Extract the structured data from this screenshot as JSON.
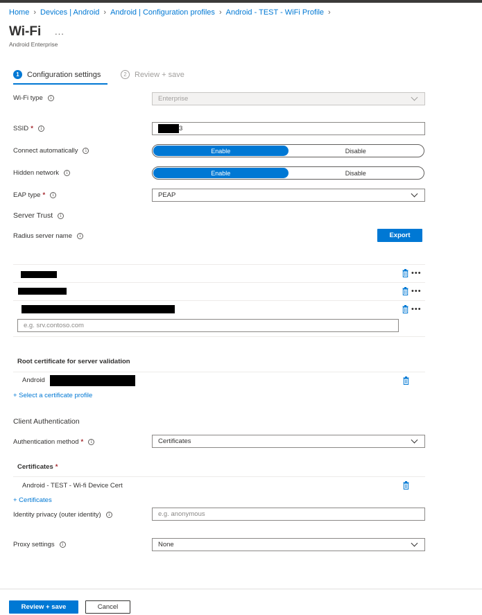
{
  "breadcrumb": [
    "Home",
    "Devices | Android",
    "Android | Configuration profiles",
    "Android - TEST - WiFi Profile"
  ],
  "header": {
    "title": "Wi-Fi",
    "more": "...",
    "subtitle": "Android Enterprise"
  },
  "steps": [
    {
      "num": "1",
      "label": "Configuration settings"
    },
    {
      "num": "2",
      "label": "Review + save"
    }
  ],
  "form": {
    "wifi_type": {
      "label": "Wi-Fi type",
      "value": "Enterprise"
    },
    "ssid": {
      "label": "SSID",
      "value": "3"
    },
    "connect_auto": {
      "label": "Connect automatically",
      "on": "Enable",
      "off": "Disable",
      "selected": "Enable"
    },
    "hidden_network": {
      "label": "Hidden network",
      "on": "Enable",
      "off": "Disable",
      "selected": "Enable"
    },
    "eap_type": {
      "label": "EAP type",
      "value": "PEAP"
    },
    "server_trust": "Server Trust",
    "radius_server_name": {
      "label": "Radius server name",
      "export": "Export",
      "placeholder": "e.g. srv.contoso.com"
    },
    "root_cert": {
      "heading": "Root certificate for server validation",
      "row_label": "Android",
      "select_link": "+ Select a certificate profile"
    },
    "client_auth": "Client Authentication",
    "auth_method": {
      "label": "Authentication method",
      "value": "Certificates"
    },
    "certificates": {
      "heading": "Certificates",
      "row_label": "Android - TEST - Wi-fi Device Cert",
      "add_link": "+ Certificates"
    },
    "identity_privacy": {
      "label": "Identity privacy (outer identity)",
      "placeholder": "e.g. anonymous"
    },
    "proxy": {
      "label": "Proxy settings",
      "value": "None"
    }
  },
  "footer": {
    "review_save": "Review + save",
    "cancel": "Cancel"
  },
  "icons": {
    "info": "info-icon",
    "trash": "trash-icon",
    "more": "more-icon",
    "chevron": "chevron-down-icon"
  },
  "colors": {
    "accent": "#0078d4",
    "required": "#a4262c"
  }
}
